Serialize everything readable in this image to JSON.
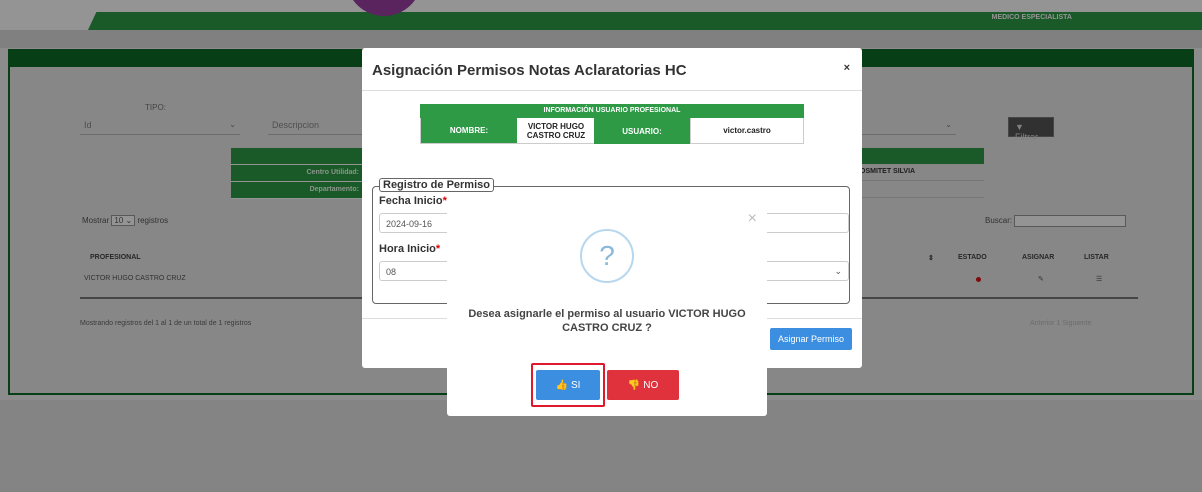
{
  "header": {
    "role": "MEDICO ESPECIALISTA"
  },
  "filters": {
    "tipo_label": "TIPO:",
    "tipo_value": "Id",
    "descripcion_placeholder": "Descripcion",
    "filtrar_label": "Filtrar"
  },
  "info_labels": [
    "Centro Utilidad:",
    "Departamento:"
  ],
  "info_right_value": "OSMITET SILVIA",
  "table": {
    "show_prefix": "Mostrar",
    "show_value": "10",
    "show_suffix": "registros",
    "search_label": "Buscar:",
    "headers": {
      "profesional": "PROFESIONAL",
      "estado": "ESTADO",
      "asignar": "ASIGNAR",
      "listar": "LISTAR"
    },
    "row": {
      "profesional": "VICTOR HUGO CASTRO CRUZ"
    },
    "summary": "Mostrando registros del 1 al 1 de un total de 1 registros",
    "pager": {
      "prev": "Anterior",
      "page": "1",
      "next": "Siguiente"
    }
  },
  "modal": {
    "title": "Asignación Permisos Notas Aclaratorias HC",
    "close_symbol": "×",
    "user_info": {
      "heading": "INFORMACIÓN USUARIO PROFESIONAL",
      "nombre_label": "NOMBRE:",
      "nombre_value": "VICTOR HUGO CASTRO CRUZ",
      "usuario_label": "USUARIO:",
      "usuario_value": "victor.castro"
    },
    "legend": "Registro de Permiso",
    "fecha_label": "Fecha Inicio",
    "fecha_value": "2024-09-16",
    "hora_label": "Hora Inicio",
    "hora_value": "08",
    "required_mark": "*",
    "assign_button": "Asignar Permiso"
  },
  "confirm": {
    "icon_symbol": "?",
    "close_symbol": "×",
    "message": "Desea asignarle el permiso al usuario VICTOR HUGO CASTRO CRUZ ?",
    "yes_label": "SI",
    "no_label": "NO"
  },
  "colors": {
    "primary_green": "#2e9a45",
    "dark_green": "#0f6b25",
    "accent_blue": "#3b8ee0",
    "danger_red": "#e0323c",
    "focus_red": "#e0182d"
  }
}
